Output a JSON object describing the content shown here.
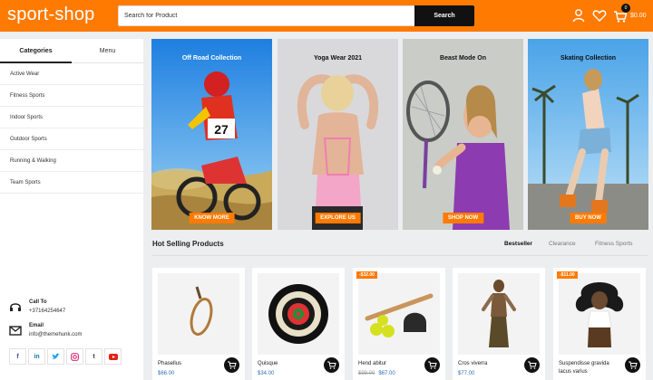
{
  "header": {
    "logo": "sport-shop",
    "search_placeholder": "Search for Product",
    "search_button": "Search",
    "cart_count": "0",
    "cart_total": "$0.00",
    "accent_color": "#ff7a00"
  },
  "sidebar": {
    "tabs": [
      "Categories",
      "Menu"
    ],
    "items": [
      "Active Wear",
      "Fitness Sports",
      "Indoor Sports",
      "Outdoor Sports",
      "Running & Walking",
      "Team Sports"
    ],
    "contact": {
      "call_label": "Call To",
      "call_value": "+37164254647",
      "email_label": "Email",
      "email_value": "info@themehunk.com"
    },
    "socials": [
      "f",
      "in",
      "tw",
      "ig",
      "t",
      "yt"
    ]
  },
  "banners": [
    {
      "title": "Off Road Collection",
      "button": "KNOW MORE"
    },
    {
      "title": "Yoga Wear 2021",
      "button": "EXPLORE US"
    },
    {
      "title": "Beast Mode On",
      "button": "SHOP NOW"
    },
    {
      "title": "Skating Collection",
      "button": "BUY NOW"
    }
  ],
  "hot": {
    "title": "Hot Selling Products",
    "tabs": [
      "Bestseller",
      "Clearance",
      "Fitness Sports"
    ],
    "products": [
      {
        "name": "Phasellus",
        "old_price": "",
        "price": "$66.00",
        "sale": ""
      },
      {
        "name": "Quisque",
        "old_price": "",
        "price": "$34.00",
        "sale": ""
      },
      {
        "name": "Hend abitur",
        "old_price": "$99.00",
        "price": "$67.00",
        "sale": "-$32.00"
      },
      {
        "name": "Cros viverra",
        "old_price": "",
        "price": "$77.00",
        "sale": ""
      },
      {
        "name": "Suspendisse gravida lacus varius",
        "old_price": "",
        "price": "",
        "sale": "-$11.00"
      }
    ]
  }
}
